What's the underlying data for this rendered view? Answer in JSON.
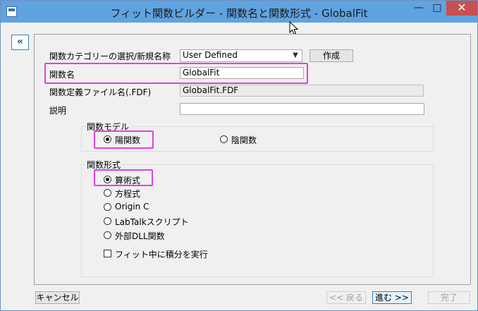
{
  "window": {
    "title": "フィット関数ビルダー - 関数名と関数形式 - GlobalFit",
    "minimize_glyph": "—",
    "maximize_glyph": "□",
    "close_glyph": "✕"
  },
  "sidebar": {
    "collapse_glyph": "«"
  },
  "form": {
    "category_label": "関数カテゴリーの選択/新規名称",
    "category_value": "User Defined",
    "create_button": "作成",
    "name_label": "関数名",
    "name_value": "GlobalFit",
    "file_label": "関数定義ファイル名(.FDF)",
    "file_value": "GlobalFit.FDF",
    "desc_label": "説明",
    "desc_value": ""
  },
  "model_group": {
    "title": "関数モデル",
    "options": [
      {
        "label": "陽関数",
        "checked": true
      },
      {
        "label": "陰関数",
        "checked": false
      }
    ]
  },
  "form_group": {
    "title": "関数形式",
    "options": [
      {
        "label": "算術式",
        "checked": true
      },
      {
        "label": "方程式",
        "checked": false
      },
      {
        "label": "Origin C",
        "checked": false
      },
      {
        "label": "LabTalkスクリプト",
        "checked": false
      },
      {
        "label": "外部DLL関数",
        "checked": false
      }
    ],
    "integrate_label": "フィット中に積分を実行",
    "integrate_checked": false
  },
  "footer": {
    "cancel": "キャンセル",
    "back": "<< 戻る",
    "next": "進む >>",
    "finish": "完了"
  },
  "icons": {
    "app": "app-icon",
    "dropdown": "chevron-down-icon",
    "cursor": "mouse-cursor-icon"
  },
  "colors": {
    "titlebar": "#5fa3e0",
    "close_button": "#c75050",
    "highlight": "#e040e0"
  }
}
